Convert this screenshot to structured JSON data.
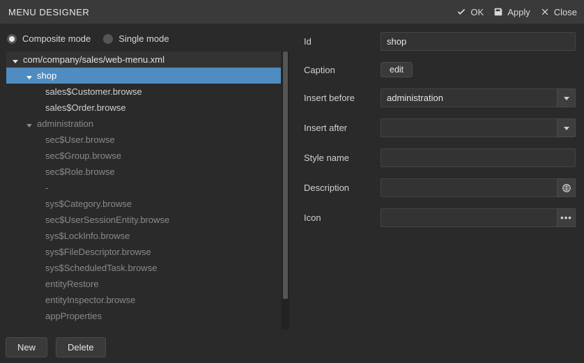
{
  "title": "MENU DESIGNER",
  "titlebar": {
    "ok": "OK",
    "apply": "Apply",
    "close": "Close"
  },
  "modes": {
    "composite": "Composite mode",
    "single": "Single mode",
    "selected": "composite"
  },
  "tree": {
    "root": "com/company/sales/web-menu.xml",
    "nodes": [
      {
        "label": "shop",
        "depth": 1,
        "selected": true,
        "expandable": true,
        "dim": false
      },
      {
        "label": "sales$Customer.browse",
        "depth": 2,
        "dim": false
      },
      {
        "label": "sales$Order.browse",
        "depth": 2,
        "dim": false
      },
      {
        "label": "administration",
        "depth": 1,
        "expandable": true,
        "dim": true
      },
      {
        "label": "sec$User.browse",
        "depth": 2,
        "dim": true
      },
      {
        "label": "sec$Group.browse",
        "depth": 2,
        "dim": true
      },
      {
        "label": "sec$Role.browse",
        "depth": 2,
        "dim": true
      },
      {
        "label": "-",
        "depth": 2,
        "dim": true
      },
      {
        "label": "sys$Category.browse",
        "depth": 2,
        "dim": true
      },
      {
        "label": "sec$UserSessionEntity.browse",
        "depth": 2,
        "dim": true
      },
      {
        "label": "sys$LockInfo.browse",
        "depth": 2,
        "dim": true
      },
      {
        "label": "sys$FileDescriptor.browse",
        "depth": 2,
        "dim": true
      },
      {
        "label": "sys$ScheduledTask.browse",
        "depth": 2,
        "dim": true
      },
      {
        "label": "entityRestore",
        "depth": 2,
        "dim": true
      },
      {
        "label": "entityInspector.browse",
        "depth": 2,
        "dim": true
      },
      {
        "label": "appProperties",
        "depth": 2,
        "dim": true
      }
    ]
  },
  "buttons": {
    "new": "New",
    "delete": "Delete"
  },
  "form": {
    "labels": {
      "id": "Id",
      "caption": "Caption",
      "insert_before": "Insert before",
      "insert_after": "Insert after",
      "style_name": "Style name",
      "description": "Description",
      "icon": "Icon"
    },
    "values": {
      "id": "shop",
      "caption_btn": "edit",
      "insert_before": "administration",
      "insert_after": "",
      "style_name": "",
      "description": "",
      "icon": ""
    }
  }
}
